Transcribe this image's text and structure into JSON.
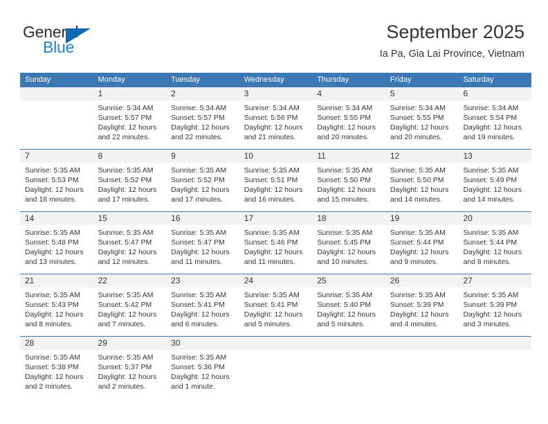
{
  "brand": {
    "name_top": "General",
    "name_bottom": "Blue",
    "triangle_color": "#1268b3",
    "blue_color": "#1a7fd4"
  },
  "header": {
    "month_title": "September 2025",
    "location": "Ia Pa, Gia Lai Province, Vietnam"
  },
  "colors": {
    "header_bar": "#3c78b4",
    "daynum_band": "#f2f2f2",
    "text": "#333333"
  },
  "weekdays": [
    "Sunday",
    "Monday",
    "Tuesday",
    "Wednesday",
    "Thursday",
    "Friday",
    "Saturday"
  ],
  "weeks": [
    [
      {
        "day": "",
        "sunrise": "",
        "sunset": "",
        "daylight_1": "",
        "daylight_2": ""
      },
      {
        "day": "1",
        "sunrise": "Sunrise: 5:34 AM",
        "sunset": "Sunset: 5:57 PM",
        "daylight_1": "Daylight: 12 hours",
        "daylight_2": "and 22 minutes."
      },
      {
        "day": "2",
        "sunrise": "Sunrise: 5:34 AM",
        "sunset": "Sunset: 5:57 PM",
        "daylight_1": "Daylight: 12 hours",
        "daylight_2": "and 22 minutes."
      },
      {
        "day": "3",
        "sunrise": "Sunrise: 5:34 AM",
        "sunset": "Sunset: 5:56 PM",
        "daylight_1": "Daylight: 12 hours",
        "daylight_2": "and 21 minutes."
      },
      {
        "day": "4",
        "sunrise": "Sunrise: 5:34 AM",
        "sunset": "Sunset: 5:55 PM",
        "daylight_1": "Daylight: 12 hours",
        "daylight_2": "and 20 minutes."
      },
      {
        "day": "5",
        "sunrise": "Sunrise: 5:34 AM",
        "sunset": "Sunset: 5:55 PM",
        "daylight_1": "Daylight: 12 hours",
        "daylight_2": "and 20 minutes."
      },
      {
        "day": "6",
        "sunrise": "Sunrise: 5:34 AM",
        "sunset": "Sunset: 5:54 PM",
        "daylight_1": "Daylight: 12 hours",
        "daylight_2": "and 19 minutes."
      }
    ],
    [
      {
        "day": "7",
        "sunrise": "Sunrise: 5:35 AM",
        "sunset": "Sunset: 5:53 PM",
        "daylight_1": "Daylight: 12 hours",
        "daylight_2": "and 18 minutes."
      },
      {
        "day": "8",
        "sunrise": "Sunrise: 5:35 AM",
        "sunset": "Sunset: 5:52 PM",
        "daylight_1": "Daylight: 12 hours",
        "daylight_2": "and 17 minutes."
      },
      {
        "day": "9",
        "sunrise": "Sunrise: 5:35 AM",
        "sunset": "Sunset: 5:52 PM",
        "daylight_1": "Daylight: 12 hours",
        "daylight_2": "and 17 minutes."
      },
      {
        "day": "10",
        "sunrise": "Sunrise: 5:35 AM",
        "sunset": "Sunset: 5:51 PM",
        "daylight_1": "Daylight: 12 hours",
        "daylight_2": "and 16 minutes."
      },
      {
        "day": "11",
        "sunrise": "Sunrise: 5:35 AM",
        "sunset": "Sunset: 5:50 PM",
        "daylight_1": "Daylight: 12 hours",
        "daylight_2": "and 15 minutes."
      },
      {
        "day": "12",
        "sunrise": "Sunrise: 5:35 AM",
        "sunset": "Sunset: 5:50 PM",
        "daylight_1": "Daylight: 12 hours",
        "daylight_2": "and 14 minutes."
      },
      {
        "day": "13",
        "sunrise": "Sunrise: 5:35 AM",
        "sunset": "Sunset: 5:49 PM",
        "daylight_1": "Daylight: 12 hours",
        "daylight_2": "and 14 minutes."
      }
    ],
    [
      {
        "day": "14",
        "sunrise": "Sunrise: 5:35 AM",
        "sunset": "Sunset: 5:48 PM",
        "daylight_1": "Daylight: 12 hours",
        "daylight_2": "and 13 minutes."
      },
      {
        "day": "15",
        "sunrise": "Sunrise: 5:35 AM",
        "sunset": "Sunset: 5:47 PM",
        "daylight_1": "Daylight: 12 hours",
        "daylight_2": "and 12 minutes."
      },
      {
        "day": "16",
        "sunrise": "Sunrise: 5:35 AM",
        "sunset": "Sunset: 5:47 PM",
        "daylight_1": "Daylight: 12 hours",
        "daylight_2": "and 11 minutes."
      },
      {
        "day": "17",
        "sunrise": "Sunrise: 5:35 AM",
        "sunset": "Sunset: 5:46 PM",
        "daylight_1": "Daylight: 12 hours",
        "daylight_2": "and 11 minutes."
      },
      {
        "day": "18",
        "sunrise": "Sunrise: 5:35 AM",
        "sunset": "Sunset: 5:45 PM",
        "daylight_1": "Daylight: 12 hours",
        "daylight_2": "and 10 minutes."
      },
      {
        "day": "19",
        "sunrise": "Sunrise: 5:35 AM",
        "sunset": "Sunset: 5:44 PM",
        "daylight_1": "Daylight: 12 hours",
        "daylight_2": "and 9 minutes."
      },
      {
        "day": "20",
        "sunrise": "Sunrise: 5:35 AM",
        "sunset": "Sunset: 5:44 PM",
        "daylight_1": "Daylight: 12 hours",
        "daylight_2": "and 8 minutes."
      }
    ],
    [
      {
        "day": "21",
        "sunrise": "Sunrise: 5:35 AM",
        "sunset": "Sunset: 5:43 PM",
        "daylight_1": "Daylight: 12 hours",
        "daylight_2": "and 8 minutes."
      },
      {
        "day": "22",
        "sunrise": "Sunrise: 5:35 AM",
        "sunset": "Sunset: 5:42 PM",
        "daylight_1": "Daylight: 12 hours",
        "daylight_2": "and 7 minutes."
      },
      {
        "day": "23",
        "sunrise": "Sunrise: 5:35 AM",
        "sunset": "Sunset: 5:41 PM",
        "daylight_1": "Daylight: 12 hours",
        "daylight_2": "and 6 minutes."
      },
      {
        "day": "24",
        "sunrise": "Sunrise: 5:35 AM",
        "sunset": "Sunset: 5:41 PM",
        "daylight_1": "Daylight: 12 hours",
        "daylight_2": "and 5 minutes."
      },
      {
        "day": "25",
        "sunrise": "Sunrise: 5:35 AM",
        "sunset": "Sunset: 5:40 PM",
        "daylight_1": "Daylight: 12 hours",
        "daylight_2": "and 5 minutes."
      },
      {
        "day": "26",
        "sunrise": "Sunrise: 5:35 AM",
        "sunset": "Sunset: 5:39 PM",
        "daylight_1": "Daylight: 12 hours",
        "daylight_2": "and 4 minutes."
      },
      {
        "day": "27",
        "sunrise": "Sunrise: 5:35 AM",
        "sunset": "Sunset: 5:39 PM",
        "daylight_1": "Daylight: 12 hours",
        "daylight_2": "and 3 minutes."
      }
    ],
    [
      {
        "day": "28",
        "sunrise": "Sunrise: 5:35 AM",
        "sunset": "Sunset: 5:38 PM",
        "daylight_1": "Daylight: 12 hours",
        "daylight_2": "and 2 minutes."
      },
      {
        "day": "29",
        "sunrise": "Sunrise: 5:35 AM",
        "sunset": "Sunset: 5:37 PM",
        "daylight_1": "Daylight: 12 hours",
        "daylight_2": "and 2 minutes."
      },
      {
        "day": "30",
        "sunrise": "Sunrise: 5:35 AM",
        "sunset": "Sunset: 5:36 PM",
        "daylight_1": "Daylight: 12 hours",
        "daylight_2": "and 1 minute."
      },
      {
        "day": "",
        "sunrise": "",
        "sunset": "",
        "daylight_1": "",
        "daylight_2": ""
      },
      {
        "day": "",
        "sunrise": "",
        "sunset": "",
        "daylight_1": "",
        "daylight_2": ""
      },
      {
        "day": "",
        "sunrise": "",
        "sunset": "",
        "daylight_1": "",
        "daylight_2": ""
      },
      {
        "day": "",
        "sunrise": "",
        "sunset": "",
        "daylight_1": "",
        "daylight_2": ""
      }
    ]
  ]
}
